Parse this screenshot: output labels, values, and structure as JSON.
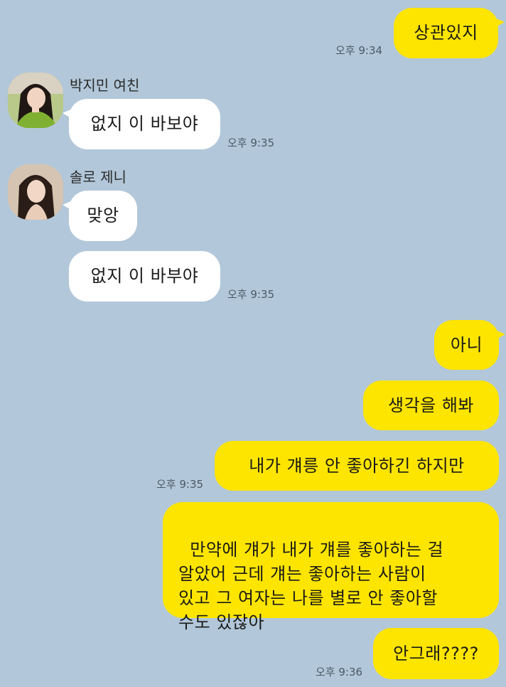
{
  "messages": {
    "m1": {
      "text": "상관있지",
      "time": "오후 9:34"
    },
    "m2": {
      "sender": "박지민 여친",
      "text": "없지 이 바보야",
      "time": "오후 9:35",
      "avatar": "avatar-woman-green-top"
    },
    "m3": {
      "sender": "솔로 제니",
      "text": "맞앙",
      "avatar": "avatar-woman-long-hair"
    },
    "m4": {
      "text": "없지 이 바부야",
      "time": "오후 9:35"
    },
    "m5": {
      "text": "아니"
    },
    "m6": {
      "text": "생각을 해봐"
    },
    "m7": {
      "text": "내가 걔릉 안 좋아하긴 하지만",
      "time": "오후 9:35"
    },
    "m8": {
      "text": "만약에 걔가 내가 걔를 좋아하는 걸\n알았어 근데 걔는 좋아하는 사람이\n있고 그 여자는 나를 별로 안 좋아할\n수도 있잖아"
    },
    "m9": {
      "text": "안그래????",
      "time": "오후 9:36"
    }
  },
  "colors": {
    "background": "#b2c7d9",
    "my_bubble": "#fee500",
    "other_bubble": "#ffffff"
  }
}
